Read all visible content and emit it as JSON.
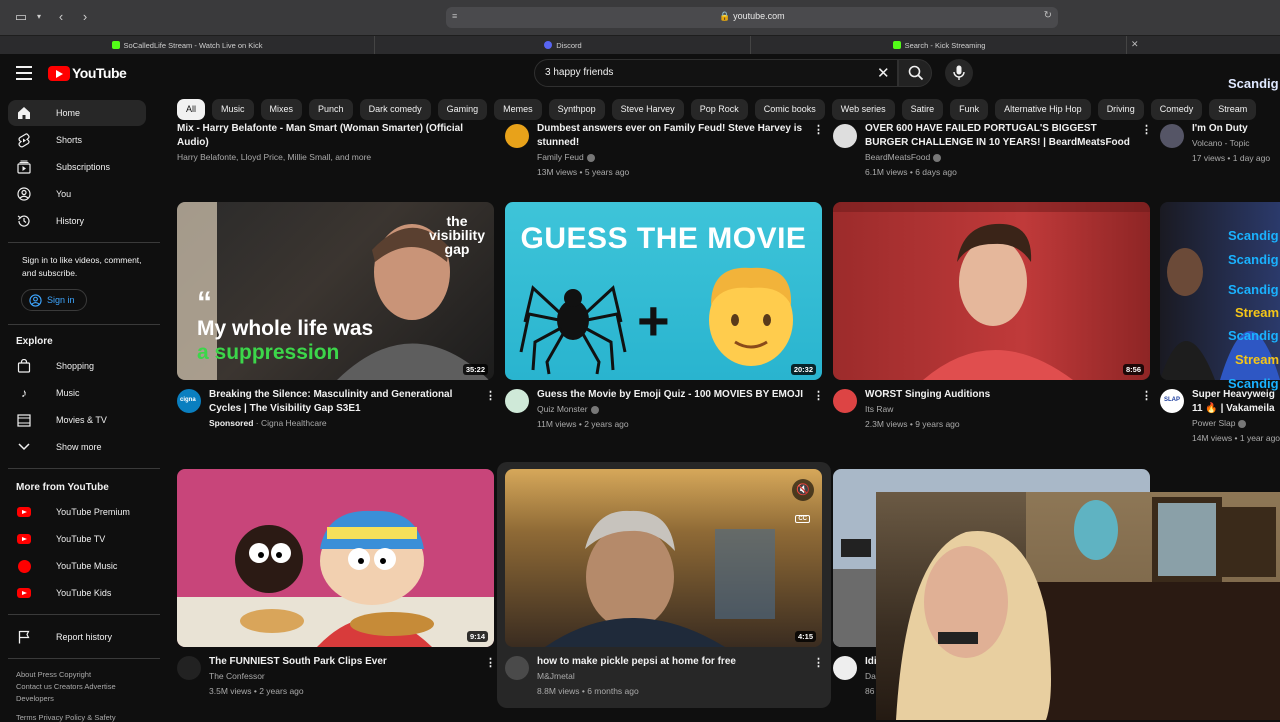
{
  "browser": {
    "url": "youtube.com",
    "tabs": [
      {
        "label": "SoCalledLife Stream - Watch Live on Kick"
      },
      {
        "label": "Discord"
      },
      {
        "label": "Search - Kick Streaming"
      }
    ]
  },
  "header": {
    "logo_text": "YouTube",
    "search_value": "3 happy friends",
    "overlay_text": "Scandig"
  },
  "chips": [
    "All",
    "Music",
    "Mixes",
    "Punch",
    "Dark comedy",
    "Gaming",
    "Memes",
    "Synthpop",
    "Steve Harvey",
    "Pop Rock",
    "Comic books",
    "Web series",
    "Satire",
    "Funk",
    "Alternative Hip Hop",
    "Driving",
    "Comedy",
    "Stream"
  ],
  "sidebar": {
    "main": [
      {
        "label": "Home",
        "icon": "home-icon"
      },
      {
        "label": "Shorts",
        "icon": "shorts-icon"
      },
      {
        "label": "Subscriptions",
        "icon": "subscriptions-icon"
      },
      {
        "label": "You",
        "icon": "you-icon"
      },
      {
        "label": "History",
        "icon": "history-icon"
      }
    ],
    "signin_prompt": "Sign in to like videos, comment, and subscribe.",
    "signin_label": "Sign in",
    "explore_heading": "Explore",
    "explore": [
      {
        "label": "Shopping",
        "icon": "shopping-icon"
      },
      {
        "label": "Music",
        "icon": "music-icon"
      },
      {
        "label": "Movies & TV",
        "icon": "movies-icon"
      },
      {
        "label": "Show more",
        "icon": "chevron-down-icon"
      }
    ],
    "more_heading": "More from YouTube",
    "more": [
      {
        "label": "YouTube Premium"
      },
      {
        "label": "YouTube TV"
      },
      {
        "label": "YouTube Music"
      },
      {
        "label": "YouTube Kids"
      }
    ],
    "report_history": "Report history",
    "footer": {
      "line1": "About  Press  Copyright",
      "line2": "Contact us  Creators  Advertise",
      "line3": "Developers",
      "line4": "Terms  Privacy  Policy & Safety"
    }
  },
  "row0": [
    {
      "title": "Mix - Harry Belafonte - Man Smart (Woman Smarter) (Official Audio)",
      "channel": "Harry Belafonte, Lloyd Price, Millie Small, and more",
      "stats": ""
    },
    {
      "title": "Dumbest answers ever on Family Feud! Steve Harvey is stunned!",
      "channel": "Family Feud",
      "stats": "13M views • 5 years ago"
    },
    {
      "title": "OVER 600 HAVE FAILED PORTUGAL'S BIGGEST BURGER CHALLENGE IN 10 YEARS! | BeardMeatsFood",
      "channel": "BeardMeatsFood",
      "stats": "6.1M views • 6 days ago"
    },
    {
      "title": "I'm On Duty",
      "channel": "Volcano - Topic",
      "stats": "17 views • 1 day ago"
    }
  ],
  "row1": [
    {
      "title": "Breaking the Silence: Masculinity and Generational Cycles | The Visibility Gap S3E1",
      "channel": "Cigna Healthcare",
      "sponsored": "Sponsored",
      "stats": "",
      "duration": "35:22",
      "thumb_quote": "My whole life was",
      "thumb_accent": "a suppression",
      "thumb_brand": "the visibility gap",
      "avatar": "cigna"
    },
    {
      "title": "Guess the Movie by Emoji Quiz - 100 MOVIES BY EMOJI",
      "channel": "Quiz Monster",
      "stats": "11M views • 2 years ago",
      "duration": "20:32",
      "thumb_text": "GUESS THE MOVIE",
      "thumb_plus": "+"
    },
    {
      "title": "WORST Singing Auditions",
      "channel": "Its Raw",
      "stats": "2.3M views • 9 years ago",
      "duration": "8:56"
    },
    {
      "title": "Super Heavyweig 11 🔥 | Vakameila",
      "channel": "Power Slap",
      "stats": "14M views • 1 year ago",
      "avatar": "SLAP"
    }
  ],
  "row2": [
    {
      "title": "The FUNNIEST South Park Clips Ever",
      "channel": "The Confessor",
      "stats": "3.5M views • 2 years ago",
      "duration": "9:14"
    },
    {
      "title": "how to make pickle  pepsi at home  for free",
      "channel": "M&Jmetal",
      "stats": "8.8M views • 6 months ago",
      "duration": "4:15",
      "cc": "CC"
    },
    {
      "title": "Idi",
      "channel": "Da",
      "stats": "86"
    }
  ],
  "stream_overlay": [
    "Scandig",
    "Scandig",
    "Scandig",
    "Stream",
    "Scandig",
    "Stream",
    "Scandig"
  ],
  "colors": {
    "accent": "#ff0000",
    "link": "#3ea6ff",
    "bg": "#0f0f0f"
  }
}
